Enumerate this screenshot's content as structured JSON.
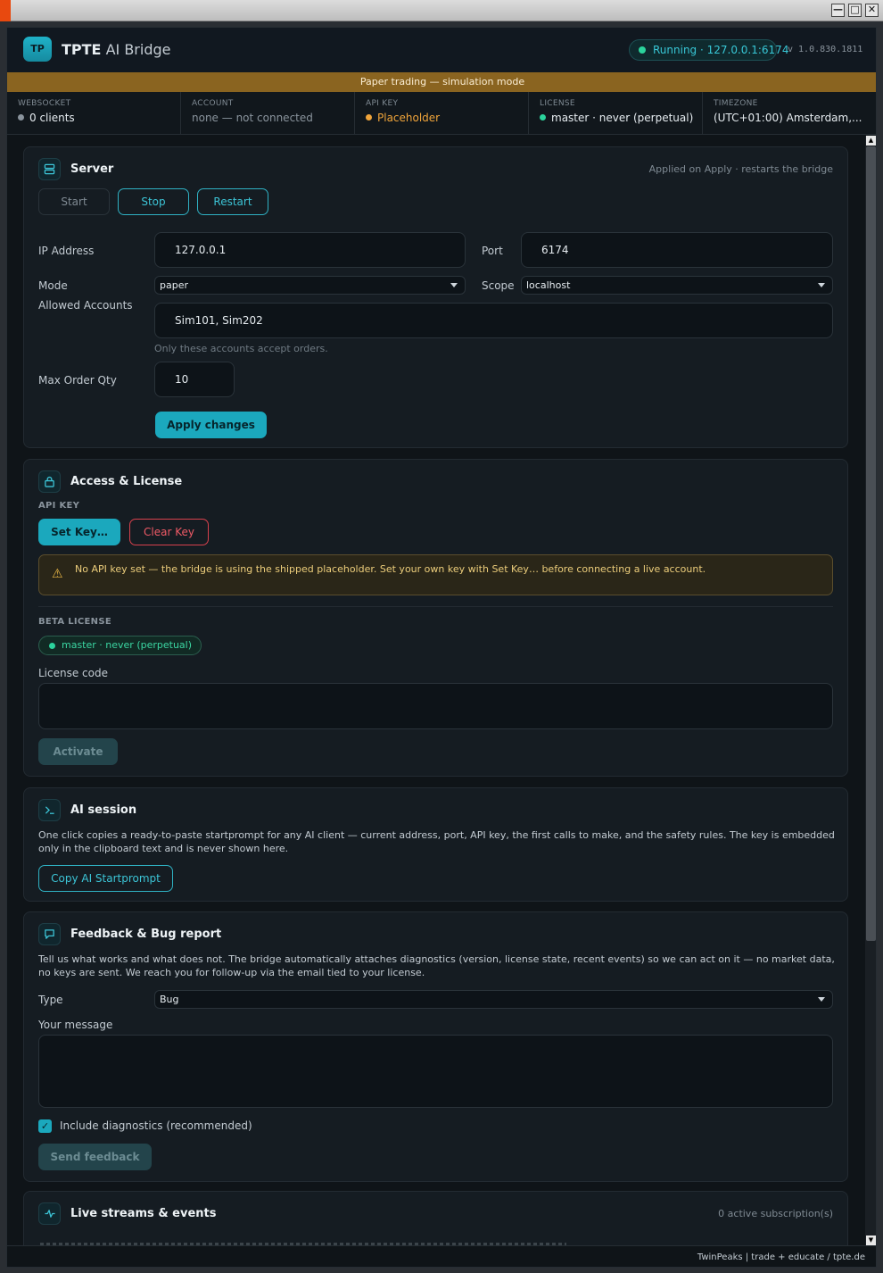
{
  "window": {
    "min": "—",
    "max": "□",
    "close": "✕"
  },
  "header": {
    "logo": "TP",
    "title_bold": "TPTE",
    "title_rest": "AI Bridge",
    "status": "Running · 127.0.0.1:6174",
    "version": "v 1.0.830.1811"
  },
  "banner": "Paper trading — simulation mode",
  "stats": [
    {
      "label": "WEBSOCKET",
      "value": "0 clients",
      "dot": "#8a949d"
    },
    {
      "label": "ACCOUNT",
      "value": "none — not connected"
    },
    {
      "label": "API KEY",
      "value": "Placeholder",
      "dot": "#f0a43a",
      "color": "#f0a43a"
    },
    {
      "label": "LICENSE",
      "value": "master · never (perpetual)",
      "dot": "#2bd39c"
    },
    {
      "label": "TIMEZONE",
      "value": "(UTC+01:00) Amsterdam,..."
    }
  ],
  "server": {
    "title": "Server",
    "meta": "Applied on Apply · restarts the bridge",
    "start": "Start",
    "stop": "Stop",
    "restart": "Restart",
    "ip_label": "IP Address",
    "ip_value": "127.0.0.1",
    "port_label": "Port",
    "port_value": "6174",
    "mode_label": "Mode",
    "mode_value": "paper",
    "scope_label": "Scope",
    "scope_value": "localhost",
    "accounts_label": "Allowed Accounts",
    "accounts_value": "Sim101, Sim202",
    "accounts_hint": "Only these accounts accept orders.",
    "maxqty_label": "Max Order Qty",
    "maxqty_value": "10",
    "apply": "Apply changes"
  },
  "access": {
    "title": "Access & License",
    "api_key_label": "API KEY",
    "set_key": "Set Key…",
    "clear_key": "Clear Key",
    "warning": "No API key set — the bridge is using the shipped placeholder. Set your own key with Set Key… before connecting a live account.",
    "beta_label": "BETA LICENSE",
    "license_badge": "master · never (perpetual)",
    "license_code_label": "License code",
    "license_code_value": "",
    "activate": "Activate"
  },
  "ai_session": {
    "title": "AI session",
    "description": "One click copies a ready-to-paste startprompt for any AI client — current address, port, API key, the first calls to make, and the safety rules. The key is embedded only in the clipboard text and is never shown here.",
    "copy": "Copy AI Startprompt"
  },
  "feedback": {
    "title": "Feedback & Bug report",
    "description": "Tell us what works and what does not. The bridge automatically attaches diagnostics (version, license state, recent events) so we can act on it — no market data, no keys are sent. We reach you for follow-up via the email tied to your license.",
    "type_label": "Type",
    "type_value": "Bug",
    "message_label": "Your message",
    "message_value": "",
    "include_diag": "Include diagnostics (recommended)",
    "include_diag_checked": true,
    "send": "Send feedback"
  },
  "streams": {
    "title": "Live streams & events",
    "meta": "0 active subscription(s)"
  },
  "footer": "TwinPeaks | trade + educate / tpte.de",
  "colors": {
    "accent": "#1ba8bd",
    "warning": "#f0a43a",
    "success": "#2bd39c",
    "danger": "#d8414d",
    "banner": "#8a6420"
  }
}
